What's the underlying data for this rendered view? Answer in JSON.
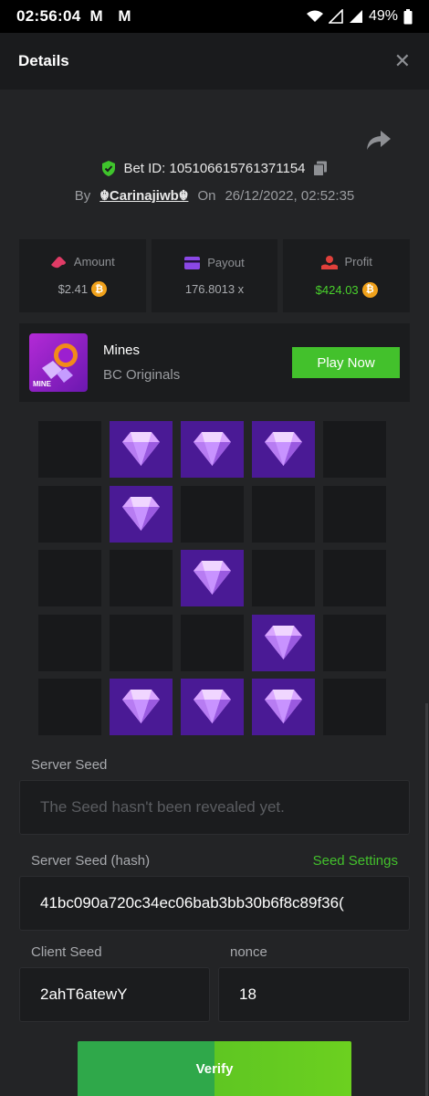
{
  "status_bar": {
    "time": "02:56:04",
    "notification_icons": "M M",
    "battery": "49%"
  },
  "header": {
    "title": "Details",
    "close_glyph": "✕"
  },
  "bet": {
    "id_label": "Bet ID: 105106615761371154",
    "by_label": "By",
    "username": "☬Carinajiwb☬",
    "on_label": "On",
    "date": "26/12/2022, 02:52:35"
  },
  "stats": {
    "amount_label": "Amount",
    "amount_value": "$2.41",
    "payout_label": "Payout",
    "payout_value": "176.8013 x",
    "profit_label": "Profit",
    "profit_value": "$424.03"
  },
  "game": {
    "thumb_text": "MINE",
    "name": "Mines",
    "provider": "BC Originals",
    "play_label": "Play Now"
  },
  "mines_grid": {
    "rows": 5,
    "cols": 5,
    "gems": [
      [
        0,
        1,
        1,
        1,
        0
      ],
      [
        0,
        1,
        0,
        0,
        0
      ],
      [
        0,
        0,
        1,
        0,
        0
      ],
      [
        0,
        0,
        0,
        1,
        0
      ],
      [
        0,
        1,
        1,
        1,
        0
      ]
    ]
  },
  "seeds": {
    "server_seed_label": "Server Seed",
    "server_seed_placeholder": "The Seed hasn't been revealed yet.",
    "server_hash_label": "Server Seed (hash)",
    "seed_settings_label": "Seed Settings",
    "server_hash_value": "41bc090a720c34ec06bab3bb30b6f8c89f36(",
    "client_seed_label": "Client Seed",
    "client_seed_value": "2ahT6atewY",
    "nonce_label": "nonce",
    "nonce_value": "18"
  },
  "verify_label": "Verify",
  "colors": {
    "background": "#232426",
    "panel": "#1b1c1e",
    "gem_cell": "#4a1a95",
    "accent_green": "#43c12c"
  },
  "icons": {
    "share": "share-icon",
    "shield": "shield-check-icon",
    "copy": "copy-icon",
    "amount": "money-icon",
    "payout": "wallet-icon",
    "profit": "profit-icon",
    "coin": "bitcoin-coin-icon",
    "gem": "diamond-icon"
  }
}
